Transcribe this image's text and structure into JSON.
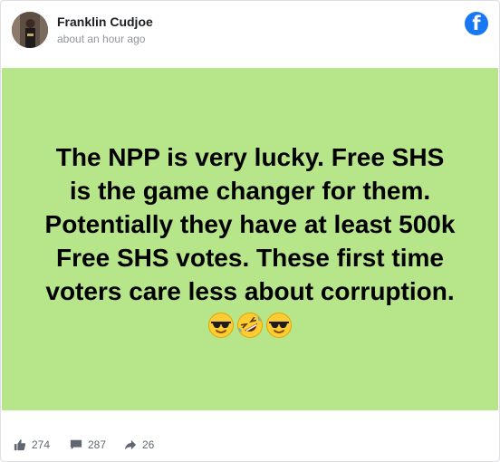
{
  "post": {
    "author": "Franklin Cudjoe",
    "timestamp": "about an hour ago",
    "text": "The NPP is very lucky. Free SHS\nis the game changer for them.\nPotentially they have at least 500k\nFree SHS votes. These first time\nvoters care less about corruption.",
    "emojis": [
      "smiling-face-with-sunglasses",
      "rolling-on-the-floor-laughing",
      "smiling-face-with-sunglasses"
    ],
    "background_color": "#b7e58a"
  },
  "stats": {
    "likes": "274",
    "comments": "287",
    "shares": "26"
  },
  "brand": {
    "facebook_blue": "#1877f2",
    "logo_letter": "f"
  }
}
